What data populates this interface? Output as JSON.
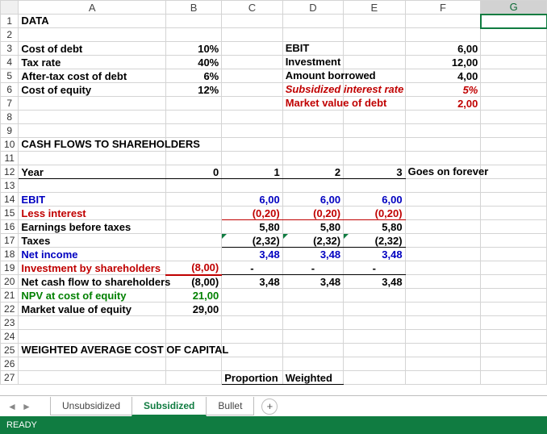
{
  "columns": [
    "A",
    "B",
    "C",
    "D",
    "E",
    "F",
    "G"
  ],
  "rows_count": 27,
  "selected_cell": "G1",
  "r1": {
    "A": "DATA"
  },
  "r3": {
    "A": "Cost of debt",
    "B": "10%",
    "D": "EBIT",
    "F": "6,00"
  },
  "r4": {
    "A": "Tax rate",
    "B": "40%",
    "D": "Investment",
    "F": "12,00"
  },
  "r5": {
    "A": "After-tax cost of debt",
    "B": "6%",
    "D": "Amount borrowed",
    "F": "4,00"
  },
  "r6": {
    "A": "Cost of equity",
    "B": "12%",
    "D": "Subsidized interest rate",
    "F": "5%"
  },
  "r7": {
    "D": "Market value of debt",
    "F": "2,00"
  },
  "r10": {
    "A": "CASH FLOWS TO SHAREHOLDERS"
  },
  "r12": {
    "A": "Year",
    "B": "0",
    "C": "1",
    "D": "2",
    "E": "3",
    "F": "Goes on forever"
  },
  "r14": {
    "A": "EBIT",
    "C": "6,00",
    "D": "6,00",
    "E": "6,00"
  },
  "r15": {
    "A": "Less interest",
    "C": "(0,20)",
    "D": "(0,20)",
    "E": "(0,20)"
  },
  "r16": {
    "A": "Earnings before taxes",
    "C": "5,80",
    "D": "5,80",
    "E": "5,80"
  },
  "r17": {
    "A": "Taxes",
    "C": "(2,32)",
    "D": "(2,32)",
    "E": "(2,32)"
  },
  "r18": {
    "A": "Net income",
    "C": "3,48",
    "D": "3,48",
    "E": "3,48"
  },
  "r19": {
    "A": "Investment by shareholders",
    "B": "(8,00)",
    "C": "-",
    "D": "-",
    "E": "-"
  },
  "r20": {
    "A": "Net cash flow to shareholders",
    "B": "(8,00)",
    "C": "3,48",
    "D": "3,48",
    "E": "3,48"
  },
  "r21": {
    "A": "NPV at cost of equity",
    "B": "21,00"
  },
  "r22": {
    "A": "Market value of equity",
    "B": "29,00"
  },
  "r25": {
    "A": "WEIGHTED AVERAGE COST OF CAPITAL"
  },
  "r27": {
    "C": "Proportion",
    "D": "Weighted"
  },
  "tabs": {
    "items": [
      "Unsubsidized",
      "Subsidized",
      "Bullet"
    ],
    "active": 1
  },
  "status": "READY"
}
